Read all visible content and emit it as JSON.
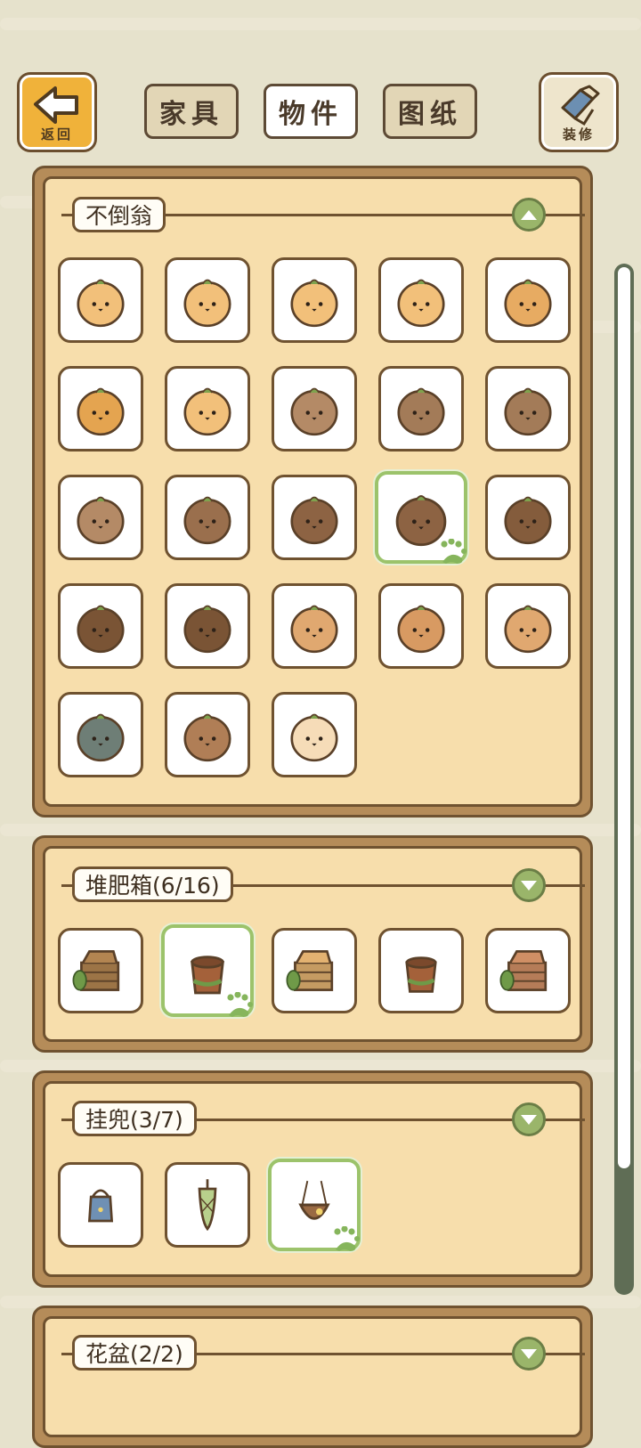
{
  "header": {
    "back_button": {
      "label": "返回",
      "icon": "arrow-left-icon",
      "color": "#f0b23a"
    },
    "tabs": [
      {
        "label": "家具",
        "active": false
      },
      {
        "label": "物件",
        "active": true
      },
      {
        "label": "图纸",
        "active": false
      }
    ],
    "decorate_button": {
      "label": "装修",
      "icon": "paint-brush-icon"
    }
  },
  "sections": [
    {
      "title": "不倒翁",
      "expanded": true,
      "toggle_icon": "chevron-up-icon",
      "items": [
        {
          "name": "tumbler-sunglasses",
          "icon": "tumbler-doll-icon",
          "color": "#f2c07a",
          "selected": false
        },
        {
          "name": "tumbler-flower-hat",
          "icon": "tumbler-doll-icon",
          "color": "#f2c07a",
          "selected": false
        },
        {
          "name": "tumbler-leaf-sprout",
          "icon": "tumbler-doll-icon",
          "color": "#f2c07a",
          "selected": false
        },
        {
          "name": "tumbler-leaf-heart",
          "icon": "tumbler-doll-icon",
          "color": "#f2c07a",
          "selected": false
        },
        {
          "name": "tumbler-striped-flower",
          "icon": "tumbler-doll-icon",
          "color": "#e7ab62",
          "selected": false
        },
        {
          "name": "tumbler-bee",
          "icon": "tumbler-doll-icon",
          "color": "#e4a450",
          "selected": false
        },
        {
          "name": "tumbler-leaf-shell",
          "icon": "tumbler-doll-icon",
          "color": "#f2c07a",
          "selected": false
        },
        {
          "name": "tumbler-egg-crack",
          "icon": "tumbler-doll-icon",
          "color": "#b48a66",
          "selected": false
        },
        {
          "name": "tumbler-grumpy",
          "icon": "tumbler-doll-icon",
          "color": "#a37b58",
          "selected": false
        },
        {
          "name": "tumbler-leaf-cap",
          "icon": "tumbler-doll-icon",
          "color": "#a37b58",
          "selected": false
        },
        {
          "name": "tumbler-brown-heart",
          "icon": "tumbler-doll-icon",
          "color": "#b48a66",
          "selected": false
        },
        {
          "name": "tumbler-glasses",
          "icon": "tumbler-doll-icon",
          "color": "#9a6f4d",
          "selected": false
        },
        {
          "name": "tumbler-sparkle-eyes",
          "icon": "tumbler-doll-icon",
          "color": "#8d6343",
          "selected": false
        },
        {
          "name": "tumbler-owl-leaf",
          "icon": "tumbler-doll-icon",
          "color": "#8d6343",
          "selected": true
        },
        {
          "name": "tumbler-plain-dark",
          "icon": "tumbler-doll-icon",
          "color": "#845c3c",
          "selected": false
        },
        {
          "name": "tumbler-dark-leaf",
          "icon": "tumbler-doll-icon",
          "color": "#7a5435",
          "selected": false
        },
        {
          "name": "tumbler-dark-sprouts",
          "icon": "tumbler-doll-icon",
          "color": "#7a5435",
          "selected": false
        },
        {
          "name": "tumbler-chick-shell",
          "icon": "tumbler-doll-icon",
          "color": "#e0a870",
          "selected": false
        },
        {
          "name": "tumbler-owl-face",
          "icon": "tumbler-doll-icon",
          "color": "#d89a62",
          "selected": false
        },
        {
          "name": "tumbler-chick-light",
          "icon": "tumbler-doll-icon",
          "color": "#e0a870",
          "selected": false
        },
        {
          "name": "tumbler-patterned-teal",
          "icon": "tumbler-doll-icon",
          "color": "#6e7e76",
          "selected": false
        },
        {
          "name": "tumbler-snail-shell",
          "icon": "tumbler-doll-icon",
          "color": "#b07e56",
          "selected": false
        },
        {
          "name": "tumbler-radish",
          "icon": "tumbler-doll-icon",
          "color": "#f6dcb8",
          "selected": false
        }
      ]
    },
    {
      "title": "堆肥箱(6/16)",
      "expanded": true,
      "toggle_icon": "chevron-down-icon",
      "items": [
        {
          "name": "compost-crate-leaves",
          "icon": "compost-crate-icon",
          "color": "#9c7446",
          "selected": false
        },
        {
          "name": "compost-barrel",
          "icon": "compost-barrel-icon",
          "color": "#a4613a",
          "selected": true
        },
        {
          "name": "compost-open-box-vine",
          "icon": "compost-crate-icon",
          "color": "#c59b62",
          "selected": false
        },
        {
          "name": "compost-barrel-leaf",
          "icon": "compost-barrel-icon",
          "color": "#a4613a",
          "selected": false
        },
        {
          "name": "compost-open-box-red",
          "icon": "compost-crate-icon",
          "color": "#b57c58",
          "selected": false
        }
      ]
    },
    {
      "title": "挂兜(3/7)",
      "expanded": true,
      "toggle_icon": "chevron-down-icon",
      "items": [
        {
          "name": "hanging-bag-blue",
          "icon": "hanging-bag-icon",
          "color": "#6f90b4",
          "selected": false
        },
        {
          "name": "hanging-net-green",
          "icon": "hanging-net-icon",
          "color": "#b8d08c",
          "selected": false
        },
        {
          "name": "hanging-basket-brown",
          "icon": "hanging-basket-icon",
          "color": "#9a6a43",
          "selected": true
        }
      ]
    },
    {
      "title": "花盆(2/2)",
      "expanded": true,
      "toggle_icon": "chevron-down-icon",
      "items": []
    }
  ],
  "scrollbar": {
    "position_fraction": 0.0,
    "visible_fraction": 0.88
  }
}
